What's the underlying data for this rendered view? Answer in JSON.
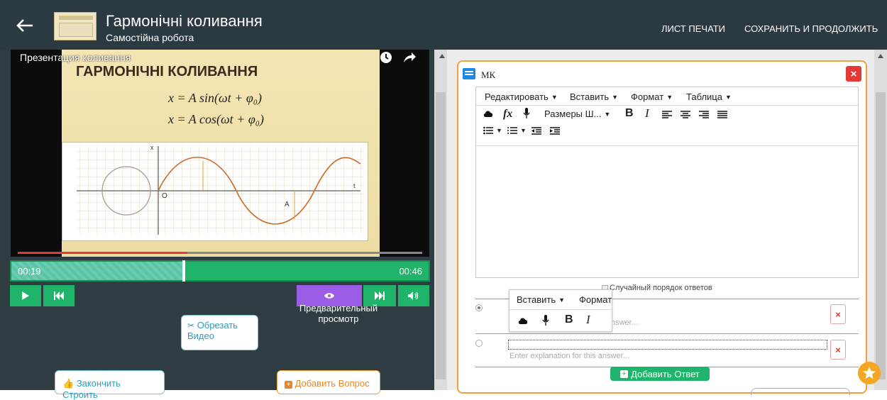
{
  "header": {
    "title": "Гармонічні коливання",
    "subtitle": "Самостійна робота",
    "print_label": "ЛИСТ ПЕЧАТИ",
    "save_label": "СОХРАНИТЬ И ПРОДОЛЖИТЬ"
  },
  "video": {
    "caption": "Презентация коливання",
    "slide_heading": "ГАРМОНІЧНІ КОЛИВАННЯ",
    "formula1": "x = A sin(ωt + φ₀)",
    "formula2": "x = A cos(ωt + φ₀)",
    "graph_label_o": "O",
    "graph_label_a": "A",
    "graph_label_x": "x",
    "graph_label_t": "t",
    "time_current": "00:19",
    "time_total": "00:46",
    "progress_fraction": 0.42,
    "preview_label": "Предварительный просмотр",
    "cut_video_label": "Обрезать Видео",
    "finish_label": "Закончить Строить",
    "add_question_label": "Добавить Вопрос"
  },
  "question": {
    "type_label": "МК",
    "menu": [
      "Редактировать",
      "Вставить",
      "Формат",
      "Таблица"
    ],
    "font_size_label": "Размеры Ш...",
    "bold": "B",
    "italic": "I",
    "random_order_label": "Случайный порядок ответов",
    "popup_insert": "Вставить",
    "popup_format": "Формат",
    "answer1_hint": "nswer...",
    "answer2_hint": "Enter explanation for this answer...",
    "add_answer_label": "Добавить Ответ",
    "remove_symbol": "×"
  },
  "colors": {
    "accent_green": "#20b46a",
    "accent_orange": "#f59e3c",
    "purple": "#9b5de5",
    "danger_red": "#e53935",
    "topbar": "#2b3a40"
  },
  "icons": {
    "back": "arrow-left-icon",
    "clock": "clock-icon",
    "share": "share-icon",
    "play": "play-icon",
    "rewind": "skip-back-icon",
    "eye": "eye-icon",
    "forward": "skip-forward-icon",
    "volume": "volume-icon",
    "scissors": "scissors-icon",
    "thumbs": "thumbs-up-icon",
    "plus": "plus-square-icon",
    "star": "star-icon"
  }
}
